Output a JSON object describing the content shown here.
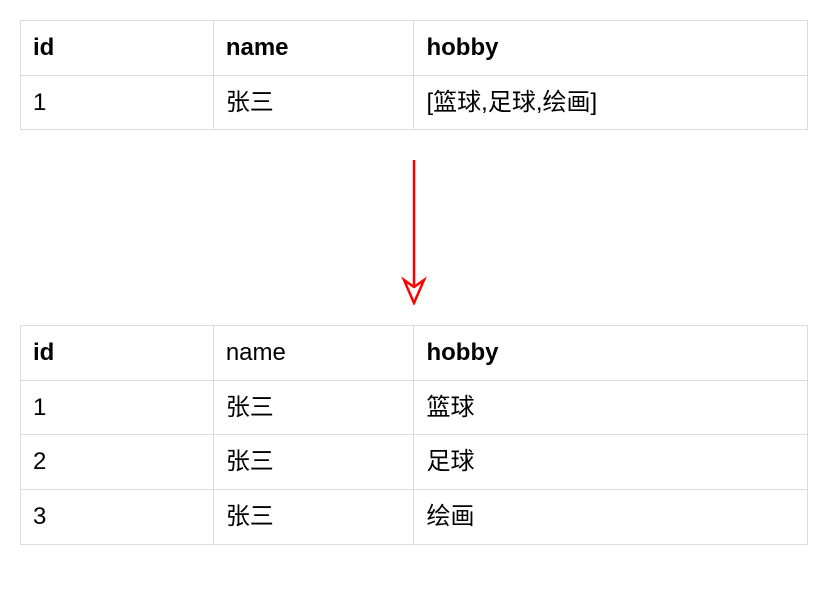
{
  "table_top": {
    "headers": {
      "id": "id",
      "name": "name",
      "hobby": "hobby"
    },
    "rows": [
      {
        "id": "1",
        "name": "张三",
        "hobby": "[篮球,足球,绘画]"
      }
    ]
  },
  "table_bottom": {
    "headers": {
      "id": "id",
      "name": "name",
      "hobby": "hobby"
    },
    "rows": [
      {
        "id": "1",
        "name": "张三",
        "hobby": "篮球"
      },
      {
        "id": "2",
        "name": "张三",
        "hobby": "足球"
      },
      {
        "id": "3",
        "name": "张三",
        "hobby": "绘画"
      }
    ]
  },
  "arrow_color": "#ff0000"
}
